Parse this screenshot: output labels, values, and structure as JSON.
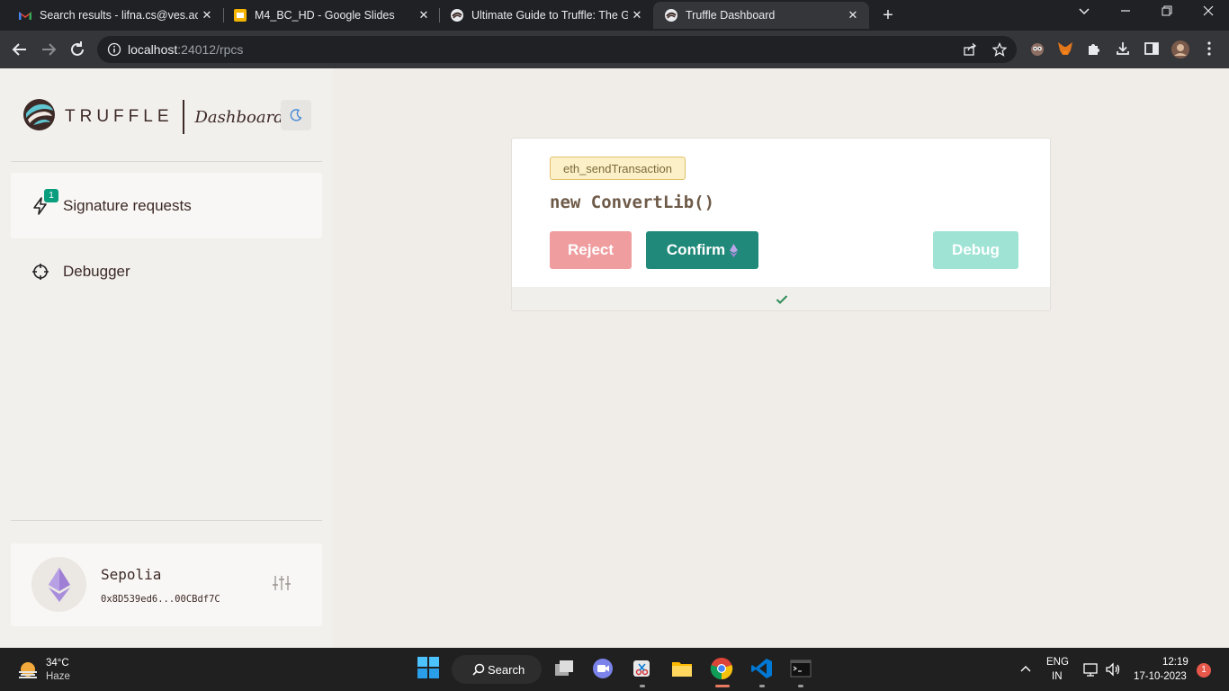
{
  "browser": {
    "tabs": [
      {
        "title": "Search results - lifna.cs@ves.ac.in",
        "favicon": "gmail-icon"
      },
      {
        "title": "M4_BC_HD - Google Slides",
        "favicon": "slides-icon"
      },
      {
        "title": "Ultimate Guide to Truffle: The Ga",
        "favicon": "truffle-icon"
      },
      {
        "title": "Truffle Dashboard",
        "favicon": "truffle-icon"
      }
    ],
    "url_host": "localhost",
    "url_path": ":24012/rpcs"
  },
  "sidebar": {
    "brand_word": "TRUFFLE",
    "brand_sub": "Dashboard",
    "nav": [
      {
        "label": "Signature requests",
        "badge": "1",
        "icon": "lightning-icon"
      },
      {
        "label": "Debugger",
        "icon": "crosshair-icon"
      }
    ],
    "network": {
      "name": "Sepolia",
      "address": "0x8D539ed6...00CBdf7C"
    }
  },
  "request": {
    "method": "eth_sendTransaction",
    "call": "new ConvertLib()",
    "reject_label": "Reject",
    "confirm_label": "Confirm",
    "debug_label": "Debug"
  },
  "taskbar": {
    "weather_temp": "34°C",
    "weather_desc": "Haze",
    "search_label": "Search",
    "lang_top": "ENG",
    "lang_bottom": "IN",
    "time": "12:19",
    "date": "17-10-2023",
    "notif_count": "1"
  }
}
